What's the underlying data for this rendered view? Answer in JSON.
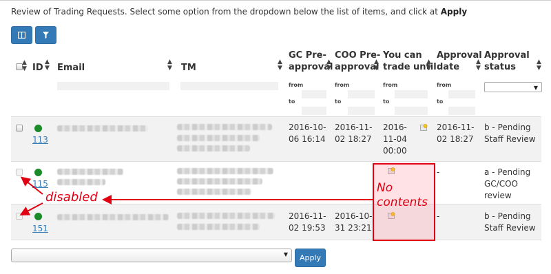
{
  "intro": {
    "text": "Review of Trading Requests. Select some option from the dropdown below the list of items, and click at ",
    "bold": "Apply"
  },
  "toolbar": {
    "columns_icon": "columns-icon",
    "filter_icon": "filter-icon"
  },
  "columns": {
    "id": "ID",
    "email": "Email",
    "tm": "TM",
    "gc": [
      "GC Pre-",
      "approval"
    ],
    "coo": [
      "COO Pre-",
      "approval"
    ],
    "trade": [
      "You can",
      "trade until"
    ],
    "appdate": [
      "Approval",
      "date"
    ],
    "status": [
      "Approval",
      "status"
    ]
  },
  "filters": {
    "from": "from",
    "to": "to"
  },
  "rows": [
    {
      "id": "113",
      "gc": [
        "2016-10-",
        "06 16:14"
      ],
      "coo": [
        "2016-11-",
        "02 18:27"
      ],
      "trade": [
        "2016-",
        "11-04",
        "00:00"
      ],
      "appdate": [
        "2016-11-",
        "02 18:27"
      ],
      "status": [
        "b - Pending",
        "Staff Review"
      ]
    },
    {
      "id": "115",
      "gc": [
        "",
        ""
      ],
      "coo": [
        "",
        ""
      ],
      "trade": [
        "",
        "",
        ""
      ],
      "appdate": [
        "-",
        ""
      ],
      "status": [
        "a - Pending",
        "GC/COO",
        "review"
      ]
    },
    {
      "id": "151",
      "gc": [
        "2016-11-",
        "02 19:53"
      ],
      "coo": [
        "2016-10-",
        "31 23:21"
      ],
      "trade": [
        "",
        "",
        ""
      ],
      "appdate": [
        "-",
        ""
      ],
      "status": [
        "b - Pending",
        "Staff Review"
      ]
    }
  ],
  "annotations": {
    "disabled": "disabled",
    "no": "No",
    "contents": "contents"
  },
  "bottom": {
    "select_value": "",
    "apply": "Apply"
  },
  "colors": {
    "accent": "#337ab7",
    "annotation": "#e00012",
    "status_dot": "#1a8a2a"
  }
}
